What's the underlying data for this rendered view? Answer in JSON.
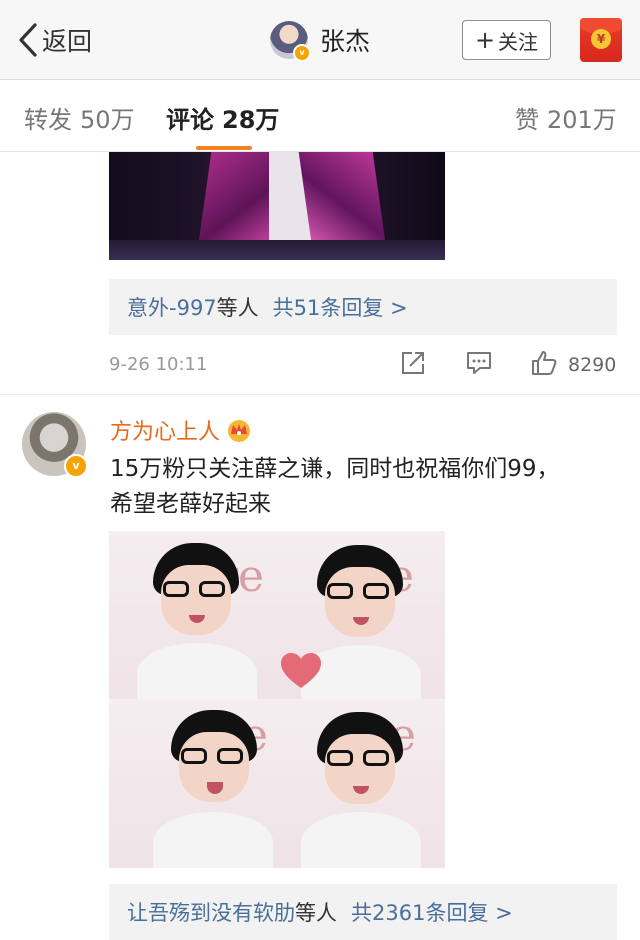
{
  "nav": {
    "back_label": "返回",
    "title": "张杰",
    "follow_label": "关注",
    "follow_plus": "+"
  },
  "tabs": [
    {
      "label": "转发",
      "count": "50万"
    },
    {
      "label": "评论",
      "count": "28万"
    },
    {
      "label": "赞",
      "count": "201万"
    }
  ],
  "comment1": {
    "reply_summary": {
      "users": "意外-997",
      "suffix": "等人",
      "total": "共51条回复 >"
    },
    "time": "9-26 10:11",
    "like_count": "8290"
  },
  "comment2": {
    "username": "方为心上人",
    "text_lines": [
      "15万粉只关注薛之谦，同时也祝福你们99，",
      "希望老薛好起来"
    ],
    "reply_summary": {
      "users": "让吾殇到没有软肋",
      "suffix": "等人",
      "total": "共2361条回复 >"
    }
  },
  "icons": {
    "back": "chevron-left-icon",
    "verified": "verified-badge-icon",
    "red_packet": "red-packet-icon",
    "share": "share-icon",
    "comment": "comment-icon",
    "like": "thumbs-up-icon",
    "crown": "crown-icon"
  },
  "colors": {
    "accent": "#f58220",
    "username": "#e86a1a",
    "link": "#4a6e9a",
    "verified": "#f5a300"
  }
}
